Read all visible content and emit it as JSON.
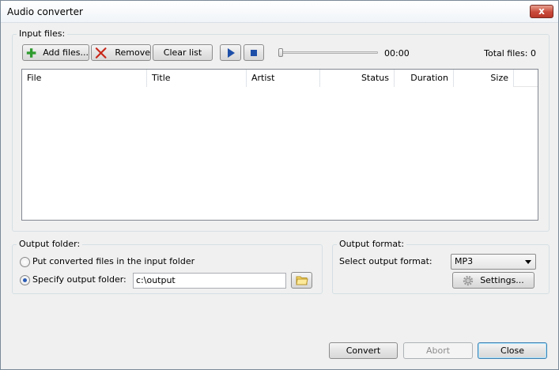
{
  "window": {
    "title": "Audio converter",
    "close_glyph": "x"
  },
  "input_files": {
    "group_label": "Input files:",
    "add_label": "Add files...",
    "remove_label": "Remove",
    "clear_label": "Clear list",
    "time": "00:00",
    "total": "Total files: 0",
    "columns": [
      "File",
      "Title",
      "Artist",
      "Status",
      "Duration",
      "Size"
    ]
  },
  "output_folder": {
    "group_label": "Output folder:",
    "option_input_folder": "Put converted files in the input folder",
    "option_specify": "Specify output folder:",
    "path_value": "c:\\output",
    "selected_option": "specify"
  },
  "output_format": {
    "group_label": "Output format:",
    "select_label": "Select output format:",
    "selected": "MP3",
    "settings_label": "Settings..."
  },
  "footer": {
    "convert_label": "Convert",
    "abort_label": "Abort",
    "close_label": "Close"
  },
  "colors": {
    "accent_blue": "#1e4fa8",
    "add_green": "#2f9b2f",
    "remove_red": "#c8271a"
  },
  "icons": {
    "add": "plus-icon",
    "remove": "x-icon",
    "play": "play-icon",
    "stop": "stop-icon",
    "browse": "folder-icon",
    "settings": "gear-icon"
  }
}
